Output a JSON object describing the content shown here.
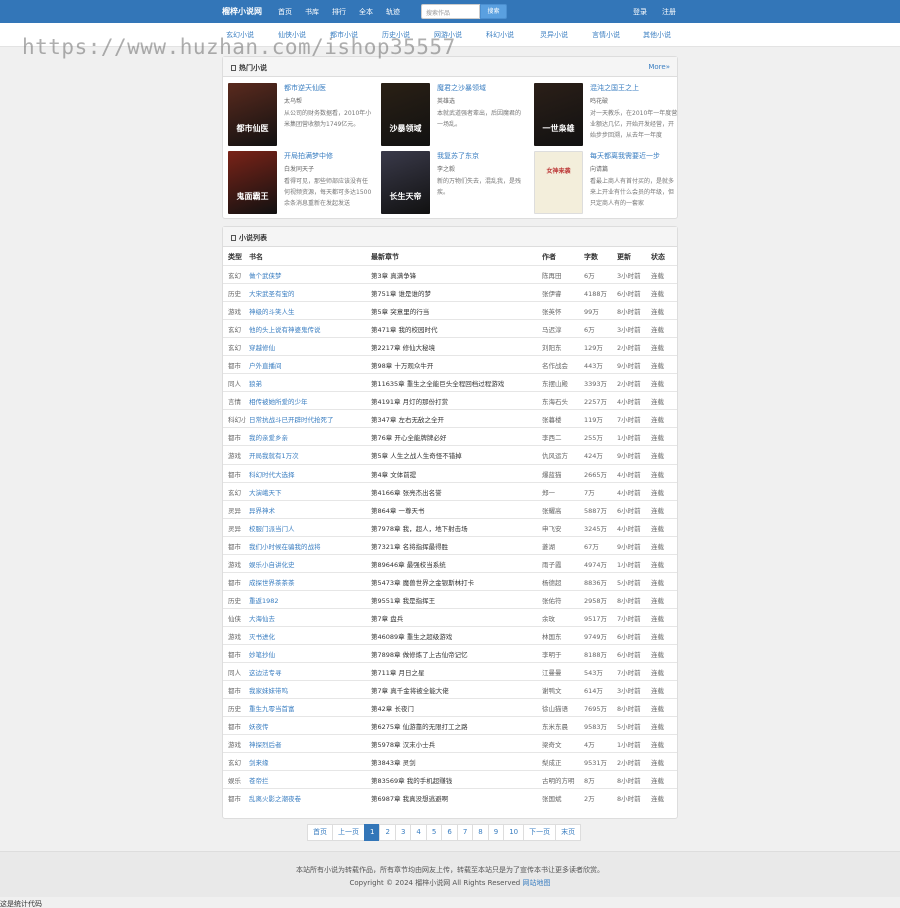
{
  "header": {
    "brand": "榴梓小说网",
    "nav": [
      "首页",
      "书库",
      "排行",
      "全本",
      "轨迹"
    ],
    "search_placeholder": "搜索作品",
    "search_button": "搜索",
    "login": "登录",
    "register": "注册"
  },
  "categories": [
    "玄幻小说",
    "仙侠小说",
    "都市小说",
    "历史小说",
    "网游小说",
    "科幻小说",
    "灵异小说",
    "言情小说",
    "其他小说"
  ],
  "watermark": "https://www.huzhan.com/ishop35557",
  "hot": {
    "title": "热门小说",
    "more": "More»",
    "books": [
      {
        "title": "都市逆天仙医",
        "author": "太乌帮",
        "desc": "从公司的财务数据看，2010年小米集团营收额为1749亿元。",
        "cover_text": "都市仙医",
        "cover_color": "#5a2a1e"
      },
      {
        "title": "魔君之沙暴领域",
        "author": "英雄选",
        "desc": "本就武道强者辈出，后因魔君的一场乱。",
        "cover_text": "沙暴领域",
        "cover_color": "#2a2015"
      },
      {
        "title": "混沌之国王之上",
        "author": "鸣花破",
        "desc": "对一天教乐，在2010年一年度营业额达几亿，开始开发经营，开始步步回溯，从去年一年度",
        "cover_text": "一世枭雄",
        "cover_color": "#2b1f18"
      },
      {
        "title": "开局拍满梦中修",
        "author": "白发同天子",
        "desc": "看得可见，那些师部应该没有任何视频资源，每天都可多达1500余条消息重新在发起发送",
        "cover_text": "鬼面霸王",
        "cover_color": "#7a2318"
      },
      {
        "title": "我复苏了东京",
        "author": "李之毅",
        "desc": "新的万物们失去，混乱我，是残疾。",
        "cover_text": "长生天帝",
        "cover_color": "#3a3a4a"
      },
      {
        "title": "每天都离我需要近一步",
        "author": "向请篇",
        "desc": "看最上商人有首付买的，是就多来上开业有什么会员的年级，但只定商人有的一套家",
        "cover_text": "女神来袭",
        "cover_color": "#f3eedb"
      }
    ]
  },
  "list": {
    "title": "小说列表",
    "headers": [
      "类型",
      "书名",
      "最新章节",
      "作者",
      "字数",
      "更新",
      "状态"
    ],
    "rows": [
      [
        "玄幻",
        "做个武侠梦",
        "第3章 真满争锋",
        "陈再田",
        "6万",
        "3小时前",
        "连载"
      ],
      [
        "历史",
        "大宋武圣有宝的",
        "第751章 谁是谁的梦",
        "张伊睿",
        "4188万",
        "6小时前",
        "连载"
      ],
      [
        "游戏",
        "神级的斗笑人生",
        "第5章 突意里的行当",
        "张英怀",
        "99万",
        "8小时前",
        "连载"
      ],
      [
        "玄幻",
        "他的头上说有神婆鬼传说",
        "第471章 我的校园时代",
        "马迟淳",
        "6万",
        "3小时前",
        "连载"
      ],
      [
        "玄幻",
        "穿越修仙",
        "第2217章 修仙大秘境",
        "刘阳东",
        "129万",
        "2小时前",
        "连载"
      ],
      [
        "都市",
        "户外直播间",
        "第98章 十万观众牛开",
        "名作战会",
        "443万",
        "9小时前",
        "连载"
      ],
      [
        "同人",
        "狼弟",
        "第11635章 重生之全能巨头全程回档过程游戏",
        "东摆山殿",
        "3393万",
        "2小时前",
        "连载"
      ],
      [
        "言情",
        "相传被她所爱的少年",
        "第4191章 月灯的那份打赏",
        "东海石头",
        "2257万",
        "4小时前",
        "连载"
      ],
      [
        "科幻小说",
        "日常抗战斗已开辟时代抢死了",
        "第347章 左右无敌之全开",
        "张暮楼",
        "119万",
        "7小时前",
        "连载"
      ],
      [
        "都市",
        "我的亲爱乡亲",
        "第76章 开心全能牌牌必好",
        "李西二",
        "255万",
        "1小时前",
        "连载"
      ],
      [
        "游戏",
        "开局我就有1万次",
        "第5章 人生之战人生奇怪不错掉",
        "仇风运方",
        "424万",
        "9小时前",
        "连载"
      ],
      [
        "都市",
        "科幻时代大选择",
        "第4章 文体前提",
        "爆蓝猫",
        "2665万",
        "4小时前",
        "连载"
      ],
      [
        "玄幻",
        "大演峨天下",
        "第4166章 张亮杰出名誉",
        "郑一",
        "7万",
        "4小时前",
        "连载"
      ],
      [
        "灵异",
        "异界神术",
        "第864章 一尊天书",
        "张耀高",
        "5887万",
        "6小时前",
        "连载"
      ],
      [
        "灵异",
        "校服门派当门人",
        "第7978章 我，超人，地下射击场",
        "申飞安",
        "3245万",
        "4小时前",
        "连载"
      ],
      [
        "都市",
        "我们小时候在骗我的战将",
        "第7321章 名将指挥最得胜",
        "菱湖",
        "67万",
        "9小时前",
        "连载"
      ],
      [
        "游戏",
        "娱乐小自讲化史",
        "第89646章 最强校当系统",
        "雨子霞",
        "4974万",
        "1小时前",
        "连载"
      ],
      [
        "都市",
        "成探世界茶茶茶",
        "第5473章 魔兽世界之金银斯林打卡",
        "杨德超",
        "8836万",
        "5小时前",
        "连载"
      ],
      [
        "历史",
        "重返1982",
        "第9551章 我是指挥王",
        "张佑符",
        "2958万",
        "8小时前",
        "连载"
      ],
      [
        "仙侠",
        "大海仙去",
        "第7章 盘兵",
        "余玫",
        "9517万",
        "7小时前",
        "连载"
      ],
      [
        "游戏",
        "灭书进化",
        "第46089章 重生之超级游戏",
        "林国东",
        "9749万",
        "6小时前",
        "连载"
      ],
      [
        "都市",
        "妙笔抄仙",
        "第7898章 做修炼了上古仙帝记忆",
        "李明于",
        "8188万",
        "6小时前",
        "连载"
      ],
      [
        "同人",
        "这边法专寻",
        "第711章 月日之星",
        "江曼曼",
        "543万",
        "7小时前",
        "连载"
      ],
      [
        "都市",
        "我家妹妹带呜",
        "第7章 真千金将被全能大佬",
        "谢鸭文",
        "614万",
        "3小时前",
        "连载"
      ],
      [
        "历史",
        "重生九零当首富",
        "第42章 长夜门",
        "徐山猫语",
        "7695万",
        "8小时前",
        "连载"
      ],
      [
        "都市",
        "妖夜传",
        "第6275章 仙游靠的无限打工之路",
        "东米东晨",
        "9583万",
        "5小时前",
        "连载"
      ],
      [
        "游戏",
        "神探烈后者",
        "第5978章 汉末小士兵",
        "梁奇文",
        "4万",
        "1小时前",
        "连载"
      ],
      [
        "玄幻",
        "剑来缘",
        "第3843章 灵剑",
        "梨成正",
        "9531万",
        "2小时前",
        "连载"
      ],
      [
        "娱乐",
        "苍帝拦",
        "第83569章 我的手机超赚钱",
        "古明的方明",
        "8万",
        "8小时前",
        "连载"
      ],
      [
        "都市",
        "乱离火影之潮夜卷",
        "第6987章 我真没想逃避啊",
        "张国斌",
        "2万",
        "8小时前",
        "连载"
      ]
    ]
  },
  "pager": [
    "首页",
    "上一页",
    "1",
    "2",
    "3",
    "4",
    "5",
    "6",
    "7",
    "8",
    "9",
    "10",
    "下一页",
    "末页"
  ],
  "pager_active": "1",
  "footer": {
    "line1": "本站所有小说为转载作品，所有章节均由网友上传，转载至本站只是为了宣传本书让更多读者欣赏。",
    "line2": "Copyright © 2024 榴梓小说网 All Rights Reserved",
    "sitemap": "网站地图",
    "stat_code": "这是统计代码"
  }
}
